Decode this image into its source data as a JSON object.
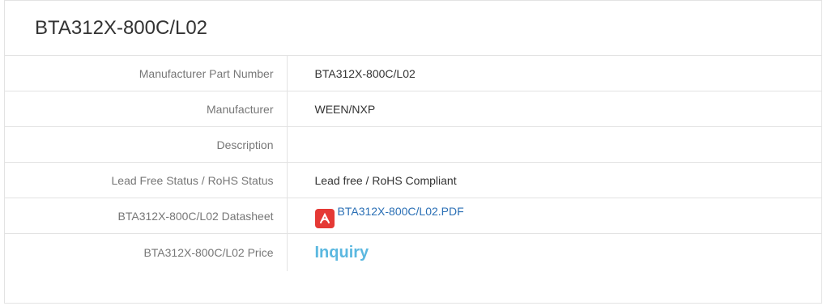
{
  "title": "BTA312X-800C/L02",
  "rows": [
    {
      "label": "Manufacturer Part Number",
      "value": "BTA312X-800C/L02"
    },
    {
      "label": "Manufacturer",
      "value": "WEEN/NXP"
    },
    {
      "label": "Description",
      "value": ""
    },
    {
      "label": "Lead Free Status / RoHS Status",
      "value": "Lead free / RoHS Compliant"
    },
    {
      "label": "BTA312X-800C/L02 Datasheet",
      "value": "BTA312X-800C/L02.PDF",
      "icon": "pdf-icon"
    },
    {
      "label": "BTA312X-800C/L02 Price",
      "value": "Inquiry"
    }
  ],
  "colors": {
    "link": "#2a6fb5",
    "inquiry": "#5bb8e0",
    "pdf": "#e53935",
    "border": "#e3e3e3"
  }
}
